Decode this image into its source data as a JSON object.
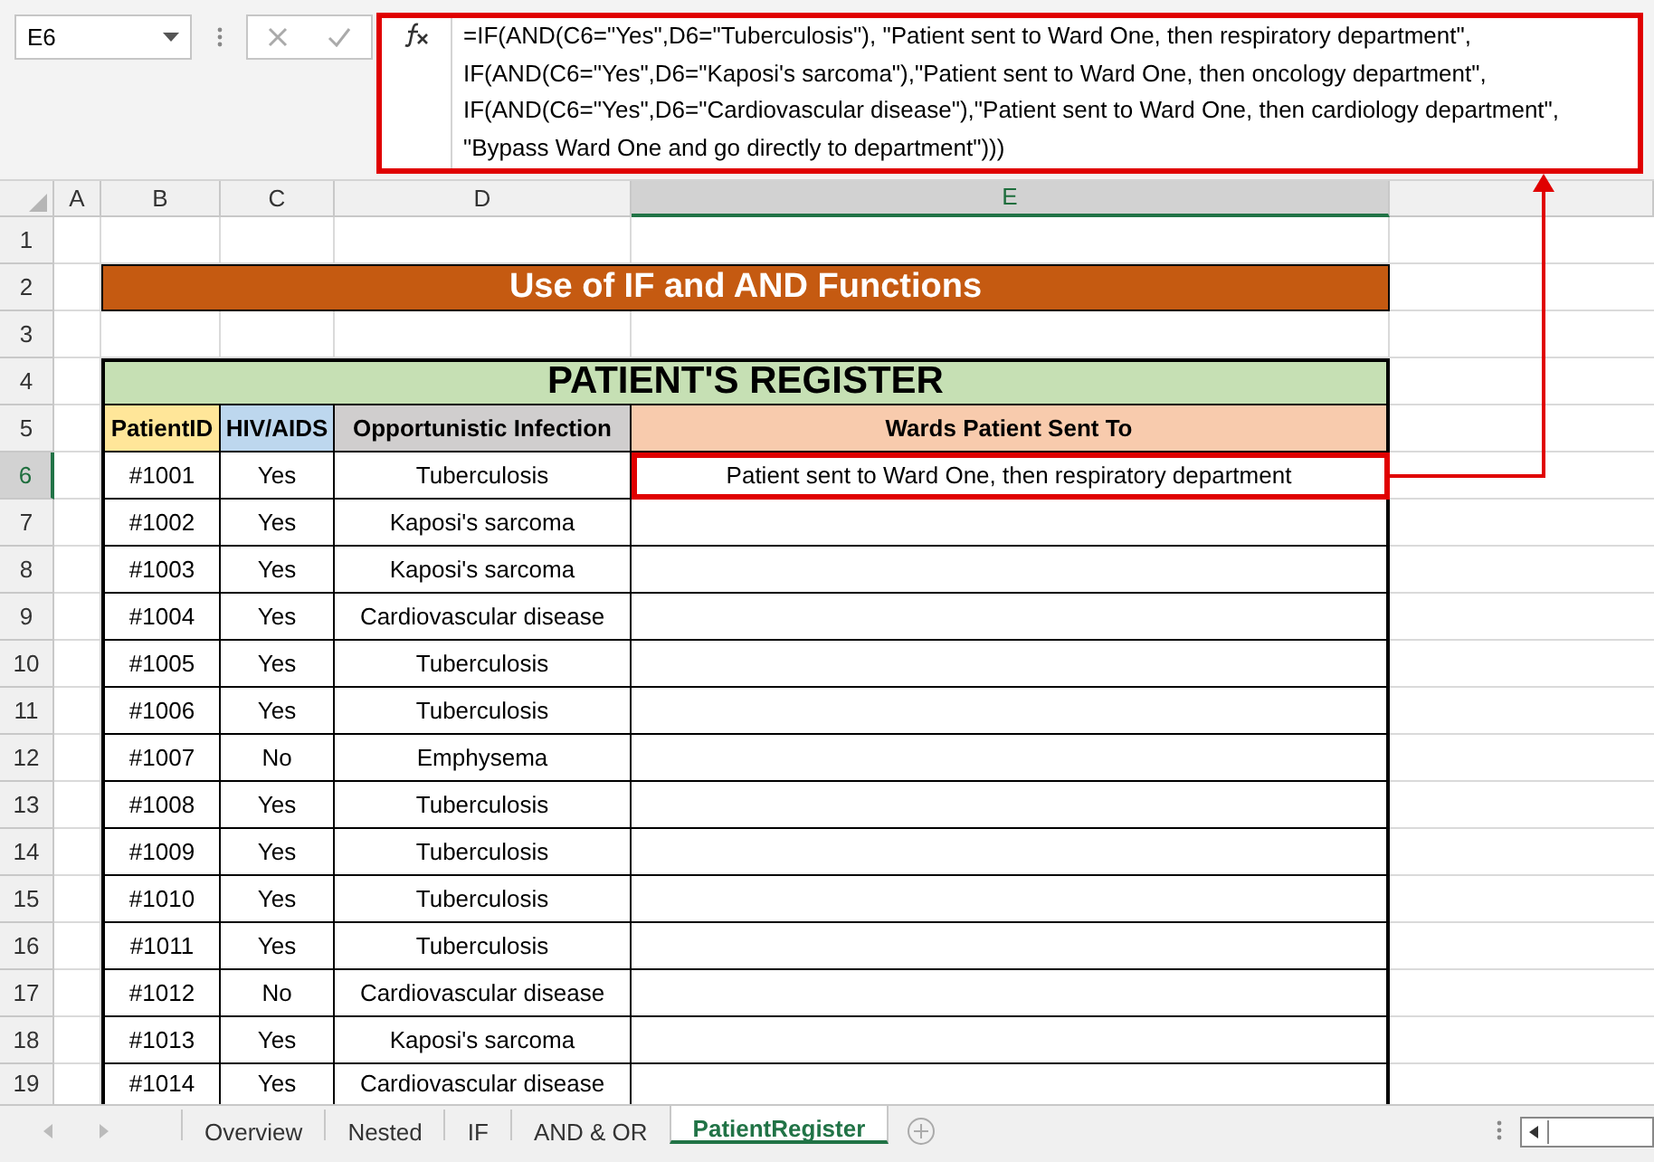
{
  "name_box": "E6",
  "formula_lines": [
    "=IF(AND(C6=\"Yes\",D6=\"Tuberculosis\"), \"Patient sent to Ward One, then respiratory department\",",
    "IF(AND(C6=\"Yes\",D6=\"Kaposi's sarcoma\"),\"Patient sent to Ward One, then oncology department\",",
    "IF(AND(C6=\"Yes\",D6=\"Cardiovascular disease\"),\"Patient sent to Ward One, then cardiology department\",",
    "\"Bypass Ward One and go directly to department\")))"
  ],
  "column_headers": [
    {
      "label": "A",
      "selected": false
    },
    {
      "label": "B",
      "selected": false
    },
    {
      "label": "C",
      "selected": false
    },
    {
      "label": "D",
      "selected": false
    },
    {
      "label": "E",
      "selected": true
    }
  ],
  "row_headers": [
    {
      "label": "1",
      "selected": false
    },
    {
      "label": "2",
      "selected": false
    },
    {
      "label": "3",
      "selected": false
    },
    {
      "label": "4",
      "selected": false
    },
    {
      "label": "5",
      "selected": false
    },
    {
      "label": "6",
      "selected": true
    },
    {
      "label": "7",
      "selected": false
    },
    {
      "label": "8",
      "selected": false
    },
    {
      "label": "9",
      "selected": false
    },
    {
      "label": "10",
      "selected": false
    },
    {
      "label": "11",
      "selected": false
    },
    {
      "label": "12",
      "selected": false
    },
    {
      "label": "13",
      "selected": false
    },
    {
      "label": "14",
      "selected": false
    },
    {
      "label": "15",
      "selected": false
    },
    {
      "label": "16",
      "selected": false
    },
    {
      "label": "17",
      "selected": false
    },
    {
      "label": "18",
      "selected": false
    },
    {
      "label": "19",
      "selected": false
    }
  ],
  "title": "Use of IF and AND Functions",
  "table": {
    "title": "PATIENT'S REGISTER",
    "columns": [
      {
        "label": "PatientID",
        "color": "#ffe699"
      },
      {
        "label": "HIV/AIDS",
        "color": "#bdd7ee"
      },
      {
        "label": "Opportunistic Infection",
        "color": "#d0cece"
      },
      {
        "label": "Wards Patient Sent To",
        "color": "#f8cbad"
      }
    ],
    "rows": [
      {
        "cells": [
          "#1001",
          "Yes",
          "Tuberculosis",
          "Patient sent to Ward One, then respiratory department"
        ],
        "selected": true
      },
      {
        "cells": [
          "#1002",
          "Yes",
          "Kaposi's sarcoma"
        ],
        "selected": false
      },
      {
        "cells": [
          "#1003",
          "Yes",
          "Kaposi's sarcoma"
        ],
        "selected": false
      },
      {
        "cells": [
          "#1004",
          "Yes",
          "Cardiovascular disease"
        ],
        "selected": false
      },
      {
        "cells": [
          "#1005",
          "Yes",
          "Tuberculosis"
        ],
        "selected": false
      },
      {
        "cells": [
          "#1006",
          "Yes",
          "Tuberculosis"
        ],
        "selected": false
      },
      {
        "cells": [
          "#1007",
          "No",
          "Emphysema"
        ],
        "selected": false
      },
      {
        "cells": [
          "#1008",
          "Yes",
          "Tuberculosis"
        ],
        "selected": false
      },
      {
        "cells": [
          "#1009",
          "Yes",
          "Tuberculosis"
        ],
        "selected": false
      },
      {
        "cells": [
          "#1010",
          "Yes",
          "Tuberculosis"
        ],
        "selected": false
      },
      {
        "cells": [
          "#1011",
          "Yes",
          "Tuberculosis"
        ],
        "selected": false
      },
      {
        "cells": [
          "#1012",
          "No",
          "Cardiovascular disease"
        ],
        "selected": false
      },
      {
        "cells": [
          "#1013",
          "Yes",
          "Kaposi's sarcoma"
        ],
        "selected": false
      },
      {
        "cells": [
          "#1014",
          "Yes",
          "Cardiovascular disease"
        ],
        "selected": false
      }
    ]
  },
  "sheet_tabs": [
    {
      "label": "Overview",
      "selected": false
    },
    {
      "label": "Nested",
      "selected": false
    },
    {
      "label": "IF",
      "selected": false
    },
    {
      "label": "AND & OR",
      "selected": false
    },
    {
      "label": "PatientRegister",
      "selected": true
    }
  ]
}
